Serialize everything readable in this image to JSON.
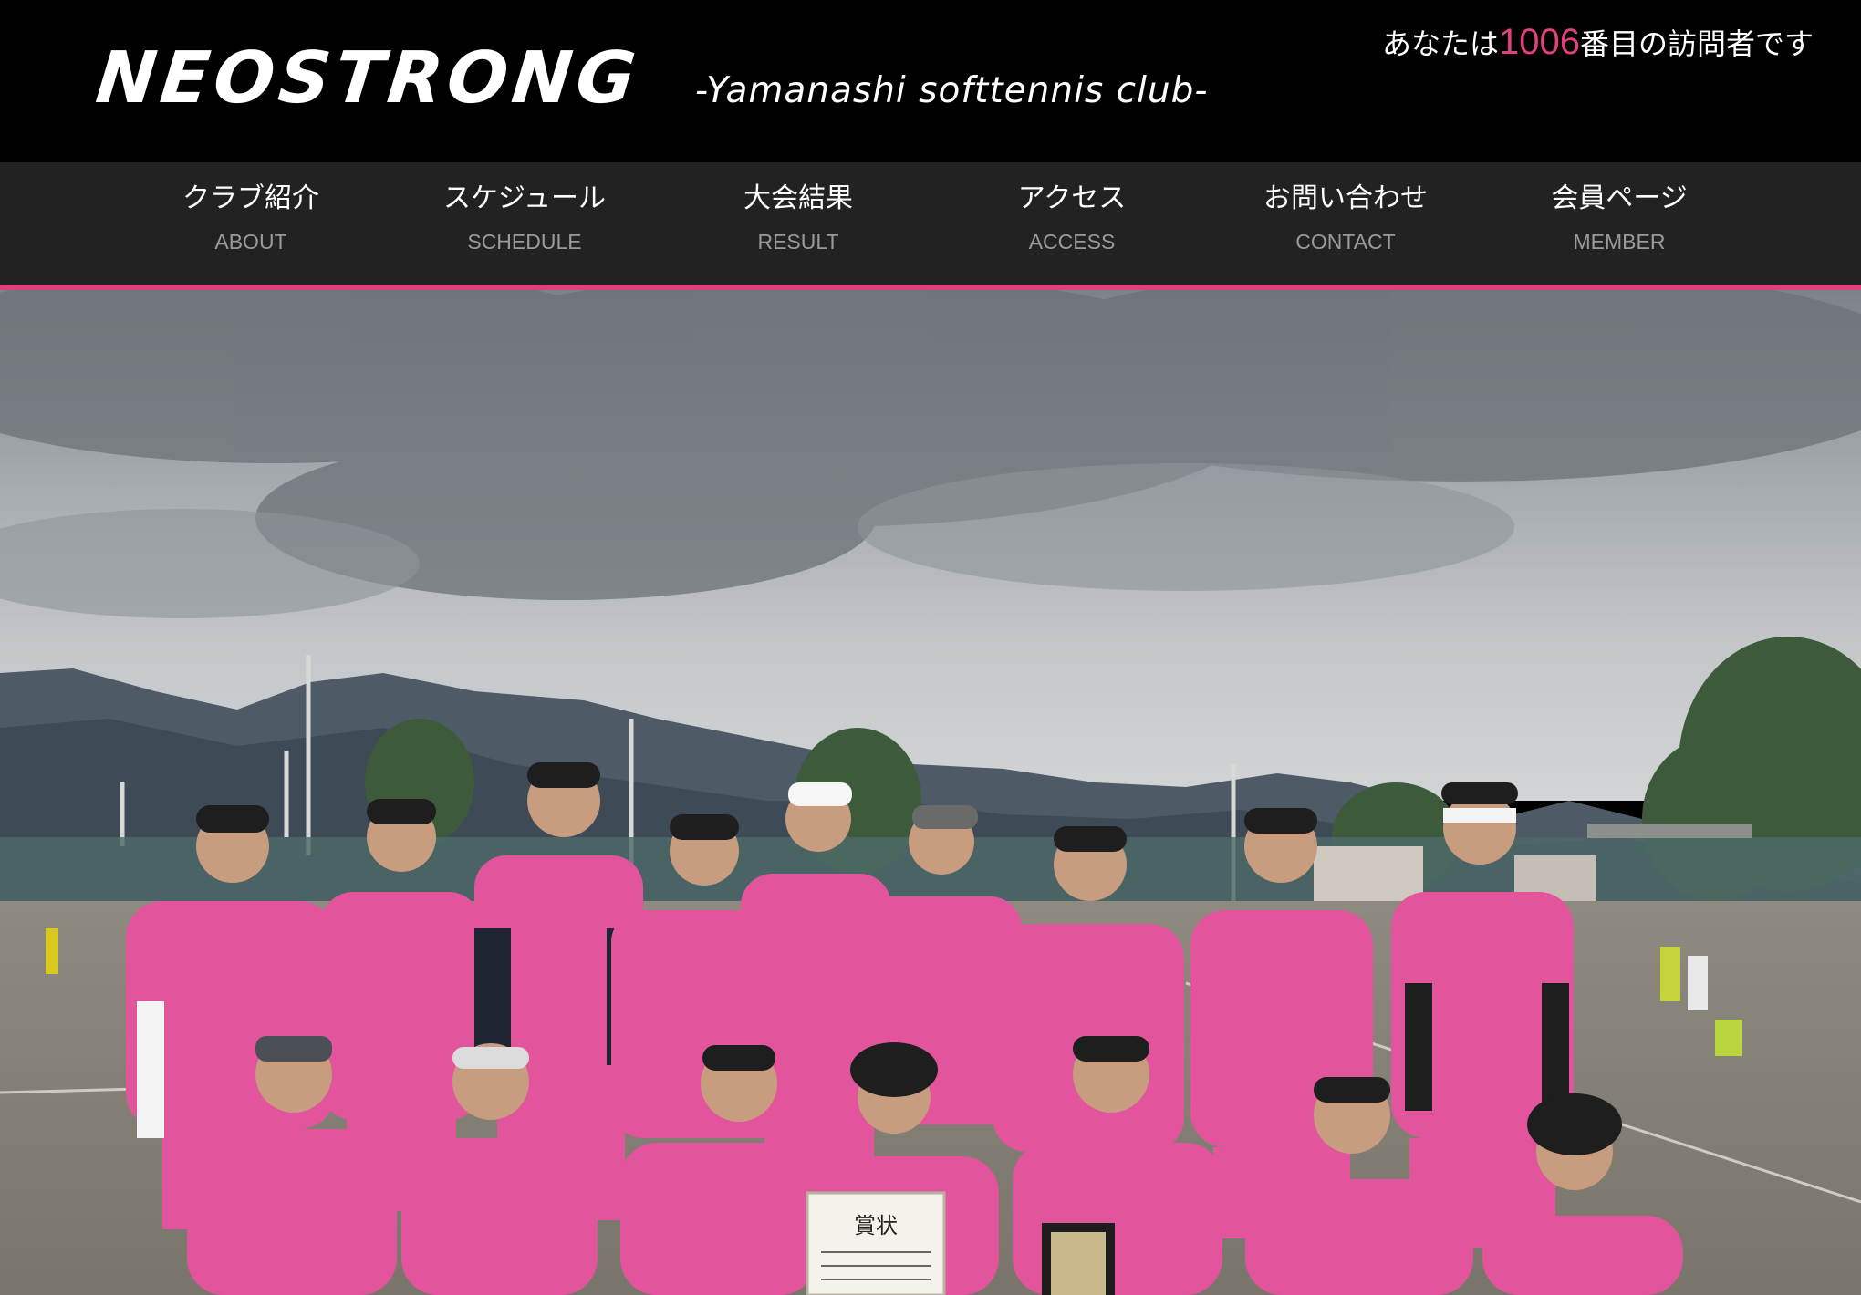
{
  "site": {
    "logo": "NEOSTRONG",
    "tagline": "-Yamanashi softtennis club-"
  },
  "counter": {
    "prefix": "あなたは",
    "count": "1006",
    "suffix": "番目の訪問者です"
  },
  "nav": {
    "items": [
      {
        "jp": "クラブ紹介",
        "en": "ABOUT"
      },
      {
        "jp": "スケジュール",
        "en": "SCHEDULE"
      },
      {
        "jp": "大会結果",
        "en": "RESULT"
      },
      {
        "jp": "アクセス",
        "en": "ACCESS"
      },
      {
        "jp": "お問い合わせ",
        "en": "CONTACT"
      },
      {
        "jp": "会員ページ",
        "en": "MEMBER"
      }
    ]
  },
  "hero": {
    "certificate_title": "賞状"
  },
  "colors": {
    "accent": "#e0407f",
    "header_bg": "#000000",
    "nav_bg": "#222222",
    "shirt_pink": "#e2559c"
  }
}
